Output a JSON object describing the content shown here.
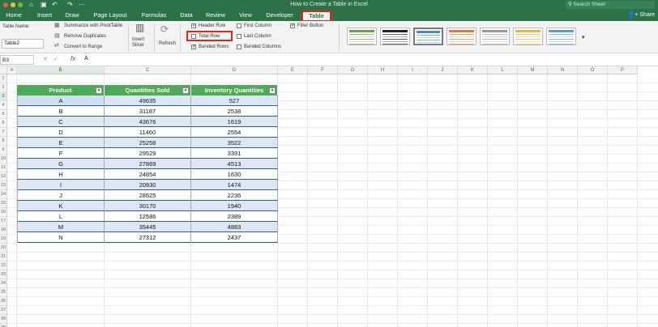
{
  "window": {
    "title": "How to Create a Table in Excel",
    "search_placeholder": "Search Sheet",
    "share_label": "Share"
  },
  "quick_access": [
    "home-icon",
    "save-icon",
    "undo-icon",
    "redo-icon",
    "more-icon"
  ],
  "tabs": [
    "Home",
    "Insert",
    "Draw",
    "Page Layout",
    "Formulas",
    "Data",
    "Review",
    "View",
    "Developer",
    "Table"
  ],
  "active_tab": "Table",
  "ribbon": {
    "table_name_label": "Table Name:",
    "table_name_value": "Table2",
    "summarize": "Summarize with PivotTable",
    "remove_duplicates": "Remove Duplicates",
    "convert_to_range": "Convert to Range",
    "insert_slicer": "Insert\nSlicer",
    "insert_slicer_l1": "Insert",
    "insert_slicer_l2": "Slicer",
    "refresh": "Refresh",
    "header_row": "Header Row",
    "total_row": "Total Row",
    "banded_rows": "Banded Rows",
    "first_column": "First Column",
    "last_column": "Last Column",
    "banded_columns": "Banded Columns",
    "filter_button": "Filter Button",
    "checks": {
      "header_row": true,
      "total_row": false,
      "banded_rows": true,
      "first_column": false,
      "last_column": false,
      "banded_columns": false,
      "filter_button": true
    },
    "styles": [
      "#6a9d4a",
      "#222222",
      "#4a86c8",
      "#e07a3a",
      "#9a9a9a",
      "#e8b83a",
      "#5b9bd5"
    ]
  },
  "formula_bar": {
    "cell_ref": "B3",
    "fx": "fx",
    "value": "A"
  },
  "columns": [
    "A",
    "B",
    "C",
    "D",
    "E",
    "F",
    "G",
    "H",
    "I",
    "J",
    "K",
    "L",
    "M",
    "N",
    "O",
    "P"
  ],
  "rows": [
    "1",
    "2",
    "3",
    "4",
    "5",
    "6",
    "7",
    "8",
    "9",
    "10",
    "11",
    "12",
    "13",
    "14",
    "15",
    "16",
    "17",
    "18",
    "19",
    "20",
    "21",
    "22",
    "23",
    "24",
    "25",
    "26",
    "27",
    "28",
    "29"
  ],
  "table": {
    "headers": [
      "Product",
      "Quantities Sold",
      "Inventory Quantities"
    ],
    "rows": [
      [
        "A",
        "49635",
        "527"
      ],
      [
        "B",
        "31187",
        "2538"
      ],
      [
        "C",
        "43676",
        "1619"
      ],
      [
        "D",
        "11460",
        "2554"
      ],
      [
        "E",
        "25258",
        "3522"
      ],
      [
        "F",
        "29529",
        "3391"
      ],
      [
        "G",
        "27869",
        "4513"
      ],
      [
        "H",
        "24854",
        "1630"
      ],
      [
        "I",
        "20930",
        "1474"
      ],
      [
        "J",
        "28525",
        "2236"
      ],
      [
        "K",
        "30170",
        "1940"
      ],
      [
        "L",
        "12586",
        "2389"
      ],
      [
        "M",
        "35445",
        "4883"
      ],
      [
        "N",
        "27312",
        "2437"
      ]
    ]
  },
  "colors": {
    "ribbon_green": "#2d7246",
    "table_header": "#4daa57",
    "highlight_box": "#e2261c"
  }
}
